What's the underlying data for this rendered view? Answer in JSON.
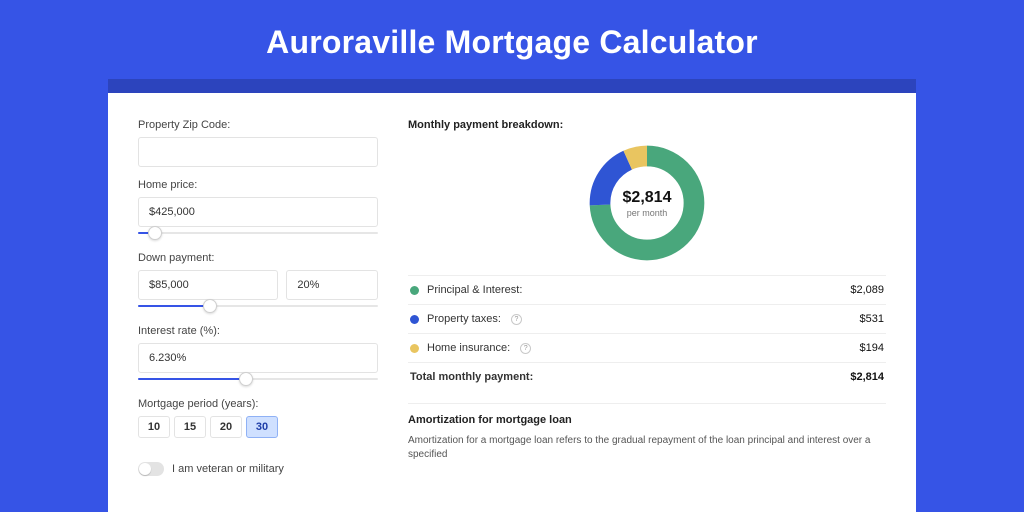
{
  "title": "Auroraville Mortgage Calculator",
  "colors": {
    "pi": "#49a77c",
    "tax": "#2f55d4",
    "ins": "#e9c560"
  },
  "form": {
    "zip_label": "Property Zip Code:",
    "zip_value": "",
    "home_price_label": "Home price:",
    "home_price_value": "$425,000",
    "home_price_pct": 7,
    "down_label": "Down payment:",
    "down_value": "$85,000",
    "down_pct_field": "20%",
    "down_slider_pct": 30,
    "rate_label": "Interest rate (%):",
    "rate_value": "6.230%",
    "rate_slider_pct": 45,
    "period_label": "Mortgage period (years):",
    "periods": [
      "10",
      "15",
      "20",
      "30"
    ],
    "period_selected_index": 3,
    "veteran_label": "I am veteran or military",
    "veteran_on": false
  },
  "breakdown": {
    "heading": "Monthly payment breakdown:",
    "center_value": "$2,814",
    "center_sub": "per month",
    "rows": [
      {
        "label": "Principal & Interest:",
        "value": "$2,089",
        "color_key": "pi",
        "share": 0.742,
        "info": false
      },
      {
        "label": "Property taxes:",
        "value": "$531",
        "color_key": "tax",
        "share": 0.189,
        "info": true
      },
      {
        "label": "Home insurance:",
        "value": "$194",
        "color_key": "ins",
        "share": 0.069,
        "info": true
      }
    ],
    "total_label": "Total monthly payment:",
    "total_value": "$2,814"
  },
  "chart_data": {
    "type": "pie",
    "title": "Monthly payment breakdown:",
    "series": [
      {
        "name": "Principal & Interest",
        "value": 2089,
        "color": "#49a77c"
      },
      {
        "name": "Property taxes",
        "value": 531,
        "color": "#2f55d4"
      },
      {
        "name": "Home insurance",
        "value": 194,
        "color": "#e9c560"
      }
    ],
    "total": 2814,
    "center_label": "$2,814 per month"
  },
  "amortization": {
    "heading": "Amortization for mortgage loan",
    "body": "Amortization for a mortgage loan refers to the gradual repayment of the loan principal and interest over a specified"
  }
}
